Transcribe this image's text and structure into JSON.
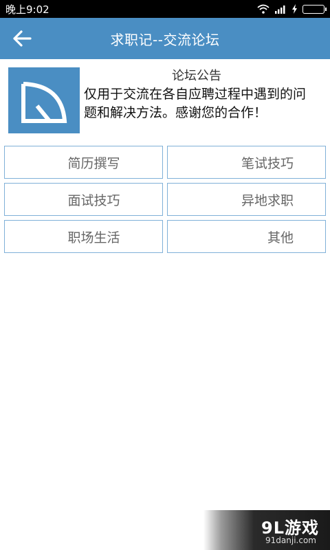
{
  "status_bar": {
    "time": "晚上9:02"
  },
  "header": {
    "title": "求职记--交流论坛"
  },
  "notice": {
    "title": "论坛公告",
    "body": "仅用于交流在各自应聘过程中遇到的问题和解决方法。感谢您的合作！"
  },
  "categories": [
    {
      "label": "简历撰写"
    },
    {
      "label": "笔试技巧"
    },
    {
      "label": "面试技巧"
    },
    {
      "label": "异地求职"
    },
    {
      "label": "职场生活"
    },
    {
      "label": "其他"
    }
  ],
  "watermark": {
    "main": "9L游戏",
    "sub": "91danji.com"
  },
  "colors": {
    "primary": "#4a8ec3",
    "border": "#7fb0d8"
  }
}
